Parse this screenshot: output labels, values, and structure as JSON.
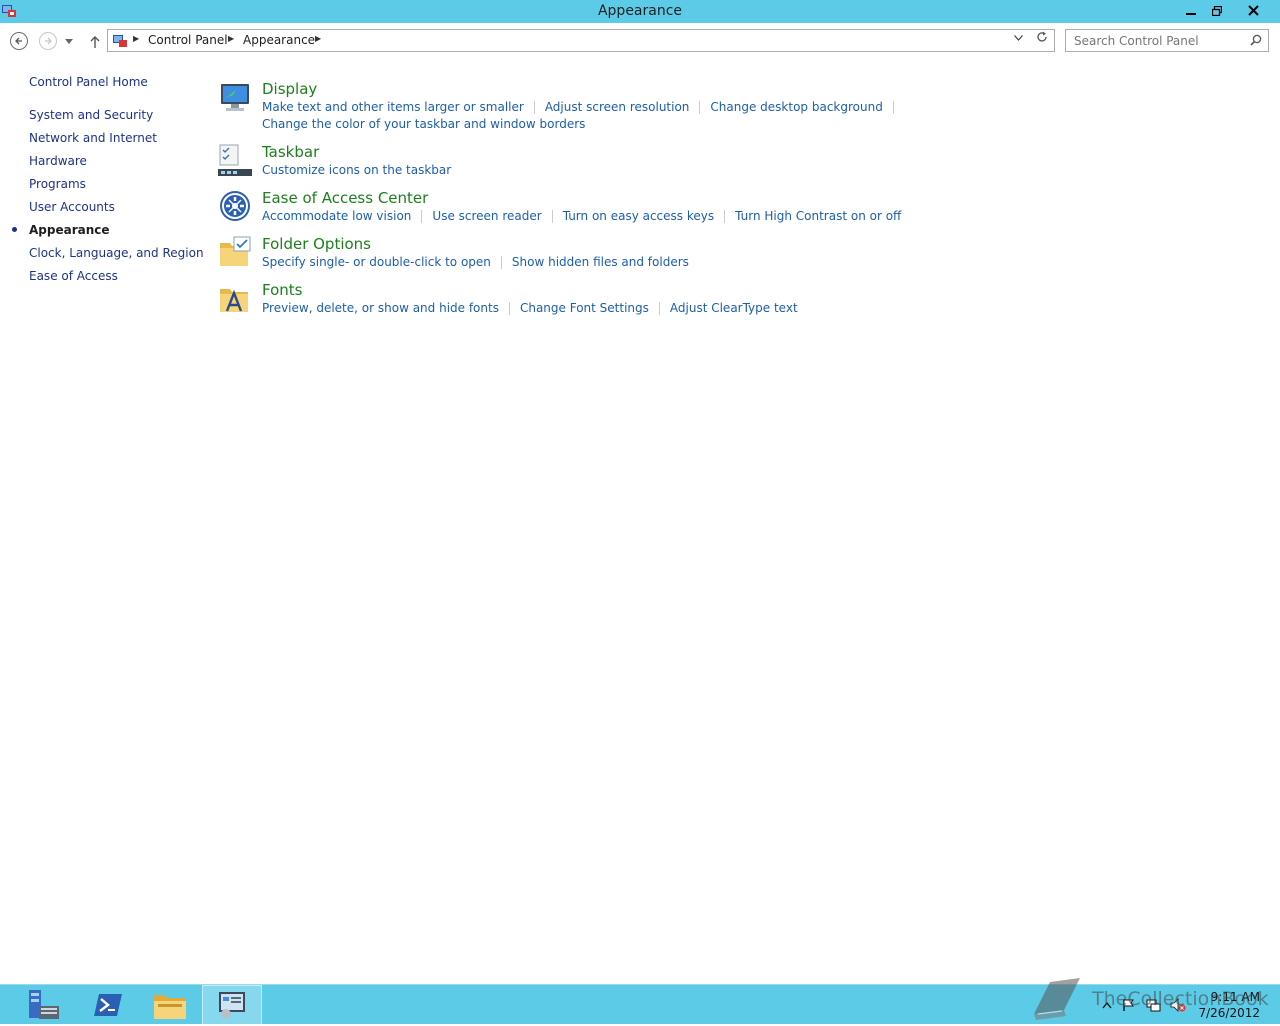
{
  "window": {
    "title": "Appearance"
  },
  "colors": {
    "title_bar": "#5ccbe8",
    "link": "#1e5ea8",
    "category_heading": "#1d7f1d",
    "nav_link": "#1e3287"
  },
  "address_bar": {
    "crumbs": [
      "Control Panel",
      "Appearance"
    ]
  },
  "search": {
    "placeholder": "Search Control Panel"
  },
  "sidebar": {
    "home": "Control Panel Home",
    "items": [
      {
        "label": "System and Security"
      },
      {
        "label": "Network and Internet"
      },
      {
        "label": "Hardware"
      },
      {
        "label": "Programs"
      },
      {
        "label": "User Accounts"
      },
      {
        "label": "Appearance",
        "current": true
      },
      {
        "label": "Clock, Language, and Region"
      },
      {
        "label": "Ease of Access"
      }
    ]
  },
  "categories": [
    {
      "heading": "Display",
      "icon": "display-monitor-icon",
      "links": [
        "Make text and other items larger or smaller",
        "Adjust screen resolution",
        "Change desktop background",
        "Change the color of your taskbar and window borders"
      ]
    },
    {
      "heading": "Taskbar",
      "icon": "taskbar-icon",
      "links": [
        "Customize icons on the taskbar"
      ]
    },
    {
      "heading": "Ease of Access Center",
      "icon": "ease-of-access-icon",
      "links": [
        "Accommodate low vision",
        "Use screen reader",
        "Turn on easy access keys",
        "Turn High Contrast on or off"
      ]
    },
    {
      "heading": "Folder Options",
      "icon": "folder-options-icon",
      "links": [
        "Specify single- or double-click to open",
        "Show hidden files and folders"
      ]
    },
    {
      "heading": "Fonts",
      "icon": "fonts-folder-icon",
      "links": [
        "Preview, delete, or show and hide fonts",
        "Change Font Settings",
        "Adjust ClearType text"
      ]
    }
  ],
  "taskbar": {
    "apps": [
      "server-manager-icon",
      "powershell-icon",
      "file-explorer-icon",
      "control-panel-icon"
    ],
    "clock_time": "9:11 AM",
    "clock_date": "7/26/2012"
  },
  "watermark": {
    "text": "TheCollectionBook"
  }
}
